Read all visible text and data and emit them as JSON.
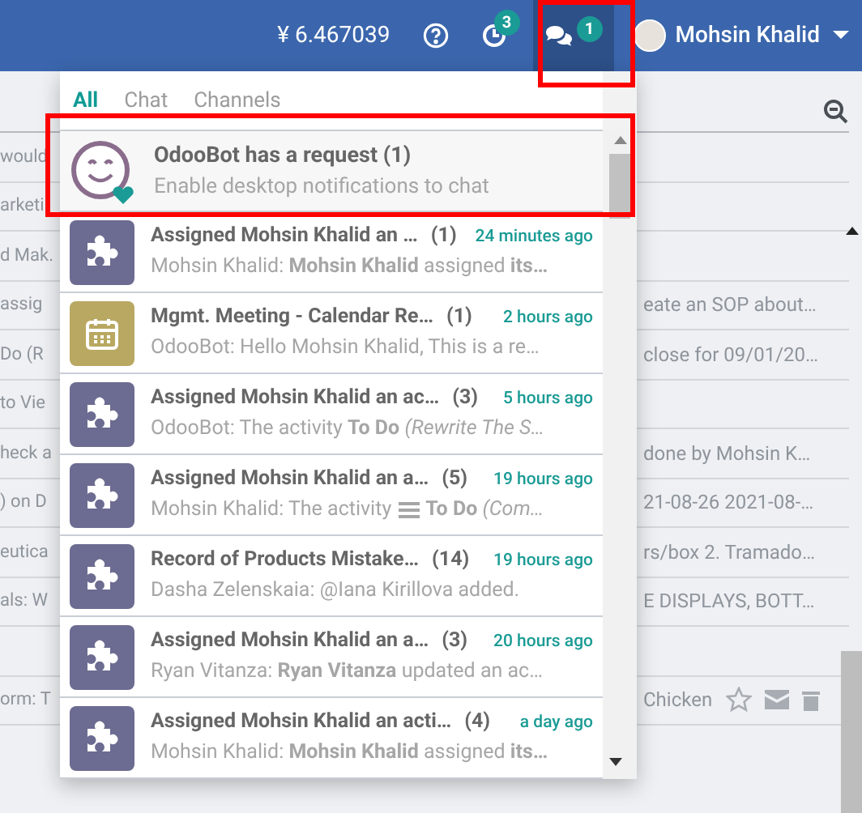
{
  "topbar": {
    "balance": "¥ 6.467039",
    "activity_badge": "3",
    "chat_badge": "1",
    "user_name": "Mohsin Khalid"
  },
  "background_rows": [
    {
      "left": "would",
      "right": ""
    },
    {
      "left": "arketi",
      "right": ""
    },
    {
      "left": "d Mak.",
      "right": ""
    },
    {
      "left": "assig",
      "right": "eate an SOP about…"
    },
    {
      "left": "Do (R",
      "right": "close for 09/01/20…"
    },
    {
      "left": "to Vie",
      "right": ""
    },
    {
      "left": "heck a",
      "right": "done by Mohsin K…"
    },
    {
      "left": ") on D",
      "right": "21-08-26 2021-08-…"
    },
    {
      "left": "eutica",
      "right": "rs/box 2. Tramado…"
    },
    {
      "left": "als: W",
      "right": "E DISPLAYS, BOTT…"
    },
    {
      "left": "",
      "right": ""
    },
    {
      "left": "orm: T",
      "right": "Chicken",
      "actions": true
    }
  ],
  "messaging": {
    "tabs": [
      {
        "label": "All",
        "selected": true
      },
      {
        "label": "Chat",
        "selected": false
      },
      {
        "label": "Channels",
        "selected": false
      }
    ],
    "request": {
      "title": "OdooBot has a request (1)",
      "subtitle": "Enable desktop notifications to chat"
    },
    "threads": [
      {
        "kind": "puzzle",
        "title": "Assigned Mohsin Khalid an …",
        "count": "(1)",
        "time": "24 minutes ago",
        "preview": "Mohsin Khalid: **Mohsin Khalid** assigned **its…**"
      },
      {
        "kind": "calendar",
        "title": "Mgmt. Meeting - Calendar Re…",
        "count": "(1)",
        "time": "2 hours ago",
        "preview": "OdooBot: Hello Mohsin Khalid, This is a re…"
      },
      {
        "kind": "puzzle",
        "title": "Assigned Mohsin Khalid an ac…",
        "count": "(3)",
        "time": "5 hours ago",
        "preview": "OdooBot: The activity **To Do** *(Rewrite The S…*"
      },
      {
        "kind": "puzzle",
        "title": "Assigned Mohsin Khalid an a…",
        "count": "(5)",
        "time": "19 hours ago",
        "preview": "Mohsin Khalid: The activity",
        "preview_rest": "**To Do** *(Com…*"
      },
      {
        "kind": "puzzle",
        "title": "Record of Products Mistake…",
        "count": "(14)",
        "time": "19 hours ago",
        "preview": "Dasha Zelenskaia: @Iana Kirillova  added."
      },
      {
        "kind": "puzzle",
        "title": "Assigned Mohsin Khalid an a…",
        "count": "(3)",
        "time": "20 hours ago",
        "preview": "Ryan Vitanza: **Ryan Vitanza** updated an ac…"
      },
      {
        "kind": "puzzle",
        "title": "Assigned Mohsin Khalid an acti…",
        "count": "(4)",
        "time": "a day ago",
        "preview": "Mohsin Khalid: **Mohsin Khalid** assigned **its…**"
      }
    ]
  }
}
